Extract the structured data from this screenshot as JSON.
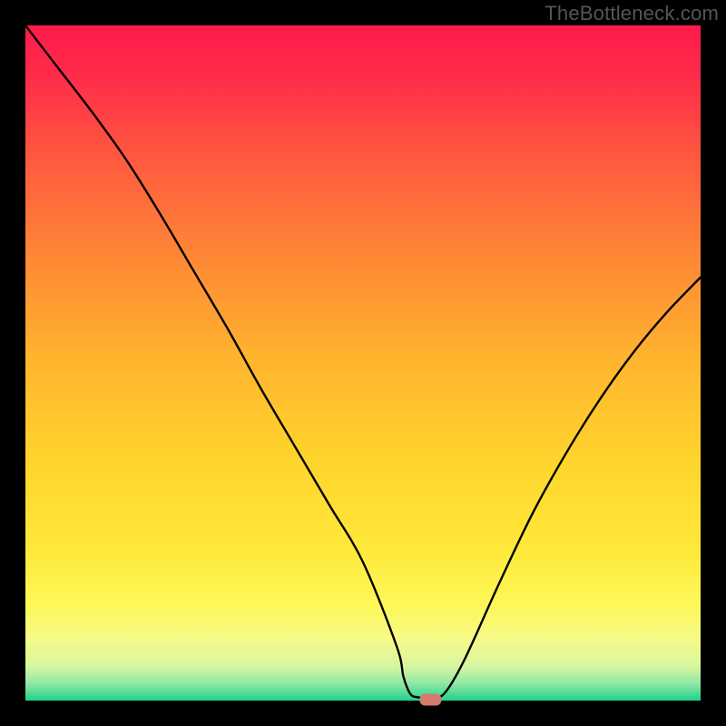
{
  "watermark": "TheBottleneck.com",
  "chart_data": {
    "type": "line",
    "title": "",
    "xlabel": "",
    "ylabel": "",
    "xlim": [
      0,
      100
    ],
    "ylim": [
      0,
      100
    ],
    "grid": false,
    "plot_background": "rainbow-vertical",
    "series": [
      {
        "name": "curve",
        "color": "#000000",
        "x": [
          0,
          5,
          10,
          15,
          20,
          25,
          30,
          35,
          40,
          45,
          50,
          55,
          56,
          57,
          58,
          59,
          60,
          62,
          65,
          70,
          75,
          80,
          85,
          90,
          95,
          100
        ],
        "y": [
          100,
          93.5,
          87,
          80,
          72,
          63.5,
          55,
          46,
          37.5,
          29,
          20.5,
          8,
          3.5,
          1.0,
          0.5,
          0.5,
          0.5,
          1.0,
          6,
          17,
          27.5,
          36.5,
          44.5,
          51.5,
          57.5,
          62.7
        ]
      }
    ],
    "marker": {
      "name": "optimum-marker",
      "x": 60,
      "y": 0,
      "color": "#d47a6f",
      "shape": "rounded-rect"
    },
    "gradient_stops": [
      {
        "offset": 0.0,
        "color": "#ff1a4b"
      },
      {
        "offset": 0.08,
        "color": "#ff2d4a"
      },
      {
        "offset": 0.2,
        "color": "#ff5a3f"
      },
      {
        "offset": 0.35,
        "color": "#ff8a35"
      },
      {
        "offset": 0.5,
        "color": "#ffb62e"
      },
      {
        "offset": 0.65,
        "color": "#ffd52c"
      },
      {
        "offset": 0.78,
        "color": "#ffe93a"
      },
      {
        "offset": 0.86,
        "color": "#fdf85a"
      },
      {
        "offset": 0.91,
        "color": "#f6fa8a"
      },
      {
        "offset": 0.95,
        "color": "#d7f6a0"
      },
      {
        "offset": 0.975,
        "color": "#8ee8a6"
      },
      {
        "offset": 1.0,
        "color": "#21d18a"
      }
    ]
  }
}
